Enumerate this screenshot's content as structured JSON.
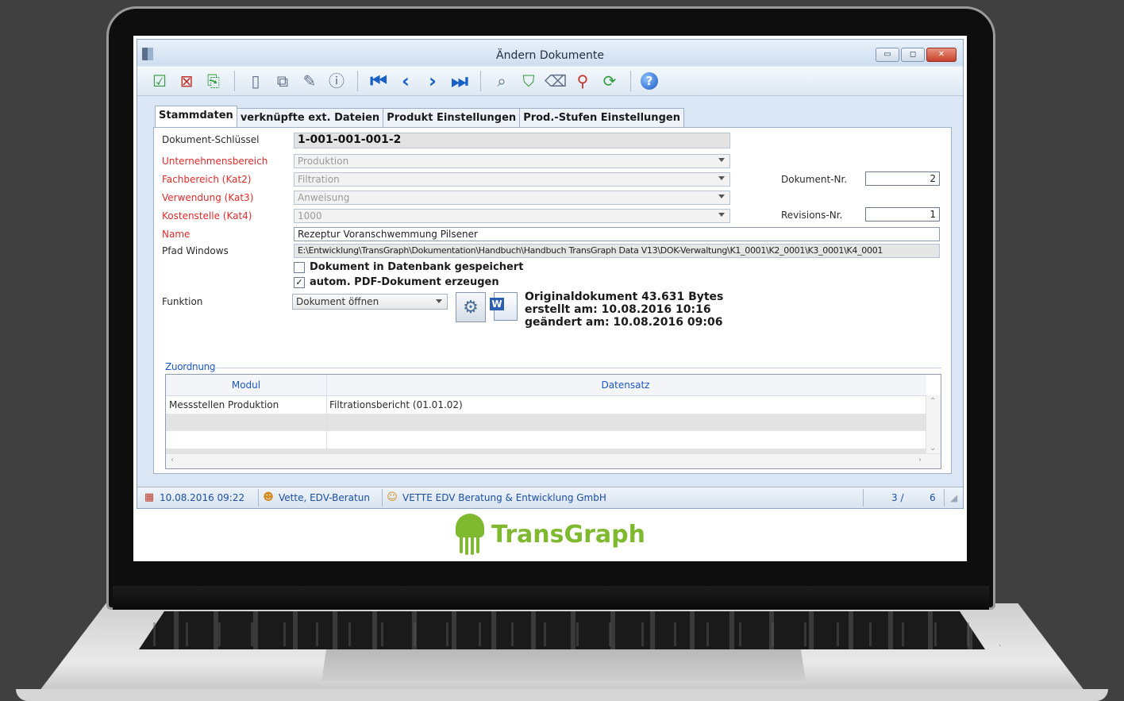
{
  "window": {
    "title": "Ändern Dokumente",
    "min_label": "▭",
    "max_label": "◻",
    "close_label": "✕"
  },
  "toolbar": {
    "icons": [
      "check-icon",
      "delete-icon",
      "save-icon",
      "new-document-icon",
      "copy-document-icon",
      "edit-document-icon",
      "document-info-icon",
      "first-record-icon",
      "previous-record-icon",
      "next-record-icon",
      "last-record-icon",
      "search-icon",
      "filter-icon",
      "clear-filter-icon",
      "find-icon",
      "refresh-search-icon",
      "help-icon"
    ],
    "help_label": "?"
  },
  "tabs": [
    {
      "label": "Stammdaten",
      "active": true
    },
    {
      "label": "verknüpfte ext. Dateien",
      "active": false
    },
    {
      "label": "Produkt Einstellungen",
      "active": false
    },
    {
      "label": "Prod.-Stufen Einstellungen",
      "active": false
    }
  ],
  "form": {
    "key_label": "Dokument-Schlüssel",
    "key_value": "1-001-001-001-2",
    "unternehmensbereich_label": "Unternehmensbereich",
    "unternehmensbereich_value": "Produktion",
    "fachbereich_label": "Fachbereich (Kat2)",
    "fachbereich_value": "Filtration",
    "verwendung_label": "Verwendung (Kat3)",
    "verwendung_value": "Anweisung",
    "kostenstelle_label": "Kostenstelle (Kat4)",
    "kostenstelle_value": "1000",
    "name_label": "Name",
    "name_value": "Rezeptur Voranschwemmung Pilsener",
    "pfad_label": "Pfad Windows",
    "pfad_value": "E:\\Entwicklung\\TransGraph\\Dokumentation\\Handbuch\\Handbuch TransGraph Data V13\\DOK-Verwaltung\\K1_0001\\K2_0001\\K3_0001\\K4_0001",
    "dokument_nr_label": "Dokument-Nr.",
    "dokument_nr_value": "2",
    "revisions_nr_label": "Revisions-Nr.",
    "revisions_nr_value": "1",
    "chk_db_label": "Dokument in Datenbank gespeichert",
    "chk_db_checked": false,
    "chk_pdf_label": "autom. PDF-Dokument erzeugen",
    "chk_pdf_checked": true,
    "chk_pdf_mark": "✓",
    "funktion_label": "Funktion",
    "funktion_value": "Dokument öffnen",
    "docinfo_line1": "Originaldokument 43.631 Bytes",
    "docinfo_line2": "erstellt am: 10.08.2016 10:16",
    "docinfo_line3": "geändert am: 10.08.2016 09:06",
    "word_label": "W"
  },
  "zuordnung": {
    "title": "Zuordnung",
    "columns": [
      "Modul",
      "Datensatz"
    ],
    "rows": [
      {
        "modul": "Messstellen Produktion",
        "datensatz": "Filtrationsbericht (01.01.02)"
      }
    ]
  },
  "status": {
    "datetime": "10.08.2016 09:22",
    "user": "Vette, EDV-Beratun",
    "company": "VETTE EDV Beratung & Entwicklung GmbH",
    "record_pos": "3 /",
    "record_total": "6"
  },
  "brand": {
    "name": "TransGraph",
    "color": "#7fb92f"
  },
  "colors": {
    "required_label": "#e02b2b",
    "accent_blue": "#1a56c7"
  }
}
